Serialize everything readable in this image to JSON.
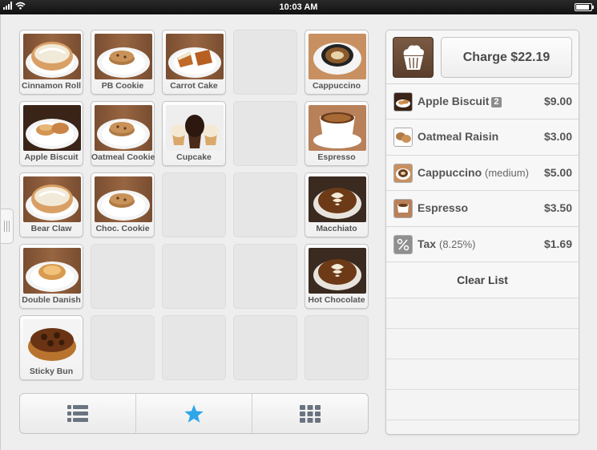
{
  "status": {
    "time": "10:03 AM",
    "battery_level": 0.9
  },
  "colors": {
    "accent_blue": "#2fa6e8",
    "brand_brown": "#6b4b36"
  },
  "menu": {
    "items": [
      {
        "label": "Cinnamon Roll",
        "icon": "pastry-photo",
        "col": 0,
        "row": 0
      },
      {
        "label": "PB Cookie",
        "icon": "cookie-photo",
        "col": 1,
        "row": 0
      },
      {
        "label": "Carrot Cake",
        "icon": "cake-slice-photo",
        "col": 2,
        "row": 0
      },
      {
        "label": "Cappuccino",
        "icon": "coffee-cup-photo",
        "col": 4,
        "row": 0
      },
      {
        "label": "Apple Biscuit",
        "icon": "biscuit-photo",
        "col": 0,
        "row": 1
      },
      {
        "label": "Oatmeal Cookie",
        "icon": "cookie-photo",
        "col": 1,
        "row": 1
      },
      {
        "label": "Cupcake",
        "icon": "cupcake-photo",
        "col": 2,
        "row": 1
      },
      {
        "label": "Espresso",
        "icon": "espresso-photo",
        "col": 4,
        "row": 1
      },
      {
        "label": "Bear Claw",
        "icon": "pastry-photo",
        "col": 0,
        "row": 2
      },
      {
        "label": "Choc. Cookie",
        "icon": "cookie-photo",
        "col": 1,
        "row": 2
      },
      {
        "label": "Macchiato",
        "icon": "latte-art-photo",
        "col": 4,
        "row": 2
      },
      {
        "label": "Double Danish",
        "icon": "danish-photo",
        "col": 0,
        "row": 3
      },
      {
        "label": "Hot Chocolate",
        "icon": "latte-art-photo",
        "col": 4,
        "row": 3
      },
      {
        "label": "Sticky Bun",
        "icon": "sticky-bun-photo",
        "col": 0,
        "row": 4
      }
    ]
  },
  "toolbar": {
    "buttons": [
      {
        "name": "list-view-button",
        "icon": "list-icon"
      },
      {
        "name": "favorites-button",
        "icon": "star-icon"
      },
      {
        "name": "grid-view-button",
        "icon": "grid-icon"
      }
    ]
  },
  "order": {
    "logo_icon": "cupcake-icon",
    "charge_label": "Charge $22.19",
    "lines": [
      {
        "name": "Apple Biscuit",
        "qty": "2",
        "modifier": "",
        "price": "$9.00",
        "thumb": "biscuit"
      },
      {
        "name": "Oatmeal Raisin",
        "qty": "",
        "modifier": "",
        "price": "$3.00",
        "thumb": "cookie"
      },
      {
        "name": "Cappuccino",
        "qty": "",
        "modifier": "(medium)",
        "price": "$5.00",
        "thumb": "coffee"
      },
      {
        "name": "Espresso",
        "qty": "",
        "modifier": "",
        "price": "$3.50",
        "thumb": "espresso"
      },
      {
        "name": "Tax",
        "qty": "",
        "modifier": "(8.25%)",
        "price": "$1.69",
        "thumb": "percent"
      }
    ],
    "clear_label": "Clear List"
  }
}
